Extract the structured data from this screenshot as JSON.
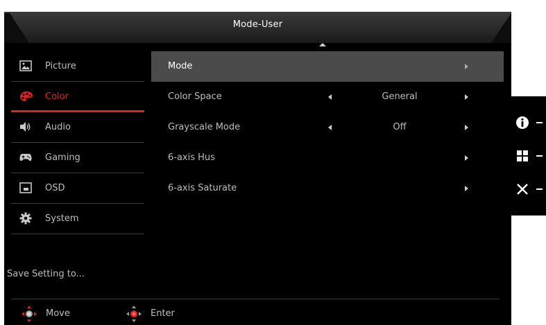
{
  "osd": {
    "title": "Mode-User"
  },
  "sidebar": {
    "items": [
      {
        "label": "Picture",
        "icon": "picture-icon"
      },
      {
        "label": "Color",
        "icon": "color-palette-icon",
        "active": true
      },
      {
        "label": "Audio",
        "icon": "speaker-icon"
      },
      {
        "label": "Gaming",
        "icon": "gamepad-icon"
      },
      {
        "label": "OSD",
        "icon": "osd-window-icon"
      },
      {
        "label": "System",
        "icon": "gear-icon"
      }
    ],
    "save_label": "Save Setting to..."
  },
  "menu": {
    "rows": [
      {
        "label": "Mode",
        "value": "",
        "selected": true
      },
      {
        "label": "Color Space",
        "value": "General"
      },
      {
        "label": "Grayscale Mode",
        "value": "Off"
      },
      {
        "label": "6-axis Hus",
        "value": ""
      },
      {
        "label": "6-axis Saturate",
        "value": ""
      }
    ]
  },
  "footer": {
    "move_label": "Move",
    "enter_label": "Enter"
  },
  "keys": [
    {
      "icon": "info-icon"
    },
    {
      "icon": "grid-icon"
    },
    {
      "icon": "close-icon"
    }
  ],
  "colors": {
    "accent": "#e0221e",
    "panel": "#000000",
    "selected_row": "#4b4b4b"
  }
}
